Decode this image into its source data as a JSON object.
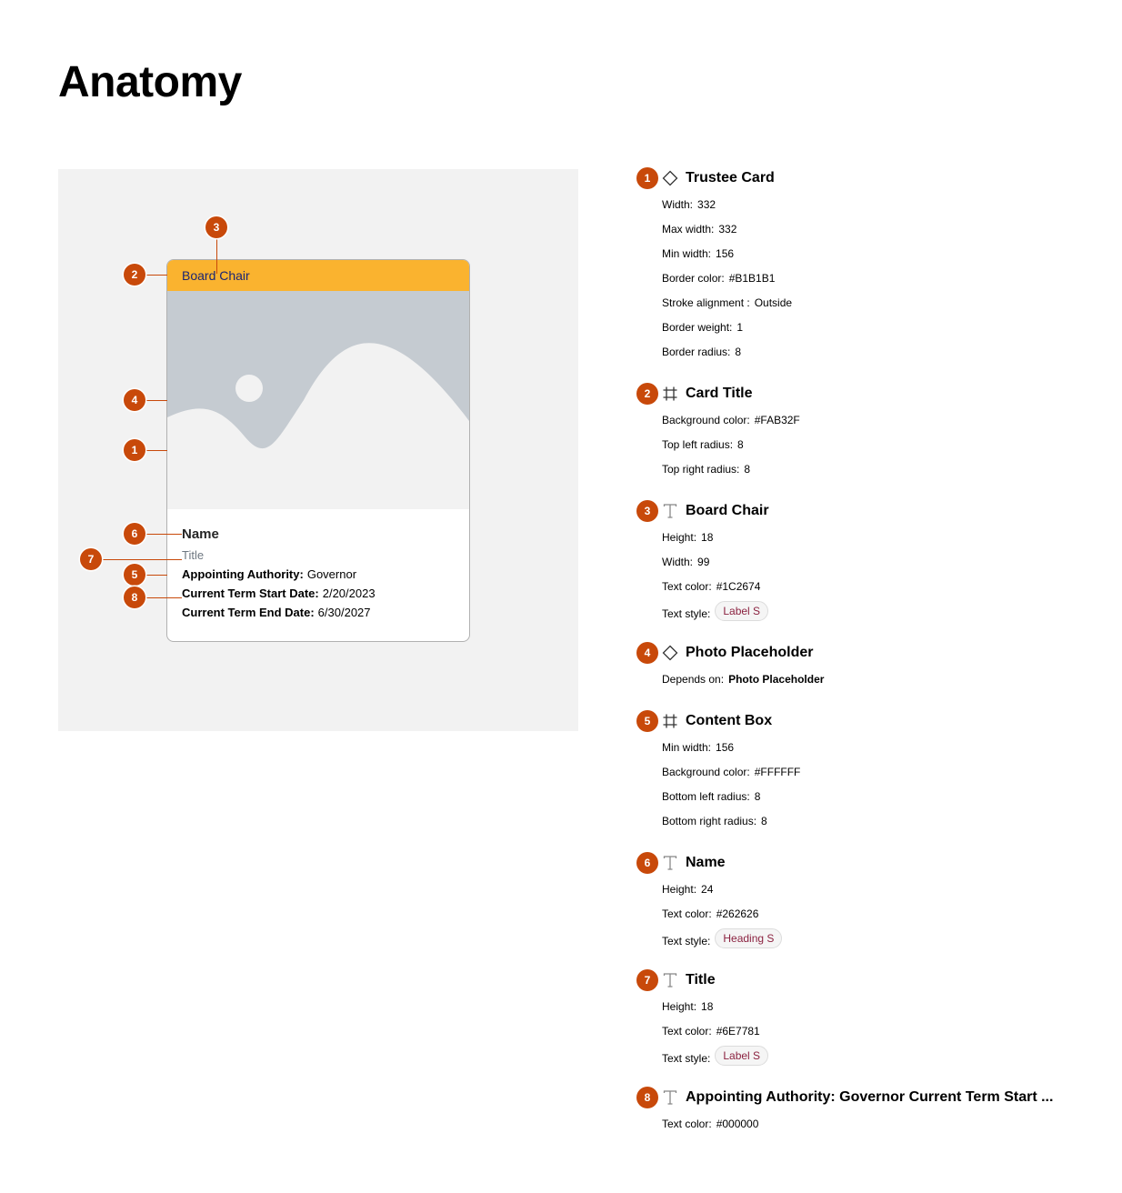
{
  "page": {
    "title": "Anatomy"
  },
  "card": {
    "title": "Board Chair",
    "name": "Name",
    "subtitle": "Title",
    "rows": [
      {
        "label": "Appointing Authority:",
        "value": "Governor"
      },
      {
        "label": "Current Term Start Date:",
        "value": "2/20/2023"
      },
      {
        "label": "Current Term End Date:",
        "value": "6/30/2027"
      }
    ]
  },
  "markers": {
    "m1": "1",
    "m2": "2",
    "m3": "3",
    "m4": "4",
    "m5": "5",
    "m6": "6",
    "m7": "7",
    "m8": "8"
  },
  "specs": [
    {
      "number": "1",
      "icon": "component-diamond-icon",
      "name": "Trustee Card",
      "props": [
        {
          "key": "Width:",
          "value": "332"
        },
        {
          "key": "Max width:",
          "value": "332"
        },
        {
          "key": "Min width:",
          "value": "156"
        },
        {
          "key": "Border color:",
          "value": "#B1B1B1"
        },
        {
          "key": "Stroke alignment :",
          "value": "Outside"
        },
        {
          "key": "Border weight:",
          "value": "1"
        },
        {
          "key": "Border radius:",
          "value": "8"
        }
      ]
    },
    {
      "number": "2",
      "icon": "frame-icon",
      "name": "Card Title",
      "props": [
        {
          "key": "Background color:",
          "value": "#FAB32F"
        },
        {
          "key": "Top left radius:",
          "value": "8"
        },
        {
          "key": "Top right radius:",
          "value": "8"
        }
      ]
    },
    {
      "number": "3",
      "icon": "text-icon",
      "name": "Board Chair",
      "props": [
        {
          "key": "Height:",
          "value": "18"
        },
        {
          "key": "Width:",
          "value": "99"
        },
        {
          "key": "Text color:",
          "value": "#1C2674"
        },
        {
          "key": "Text style:",
          "chip": "Label S"
        }
      ]
    },
    {
      "number": "4",
      "icon": "component-diamond-icon",
      "name": "Photo Placeholder",
      "props": [
        {
          "key": "Depends on:",
          "strong": "Photo Placeholder"
        }
      ]
    },
    {
      "number": "5",
      "icon": "frame-icon",
      "name": "Content Box",
      "props": [
        {
          "key": "Min width:",
          "value": "156"
        },
        {
          "key": "Background color:",
          "value": "#FFFFFF"
        },
        {
          "key": "Bottom left radius:",
          "value": "8"
        },
        {
          "key": "Bottom right radius:",
          "value": "8"
        }
      ]
    },
    {
      "number": "6",
      "icon": "text-icon",
      "name": "Name",
      "props": [
        {
          "key": "Height:",
          "value": "24"
        },
        {
          "key": "Text color:",
          "value": "#262626"
        },
        {
          "key": "Text style:",
          "chip": "Heading S"
        }
      ]
    },
    {
      "number": "7",
      "icon": "text-icon",
      "name": "Title",
      "props": [
        {
          "key": "Height:",
          "value": "18"
        },
        {
          "key": "Text color:",
          "value": "#6E7781"
        },
        {
          "key": "Text style:",
          "chip": "Label S"
        }
      ]
    },
    {
      "number": "8",
      "icon": "text-icon",
      "name": "Appointing Authority: Governor Current Term Start ...",
      "props": [
        {
          "key": "Text color:",
          "value": "#000000"
        }
      ]
    }
  ]
}
